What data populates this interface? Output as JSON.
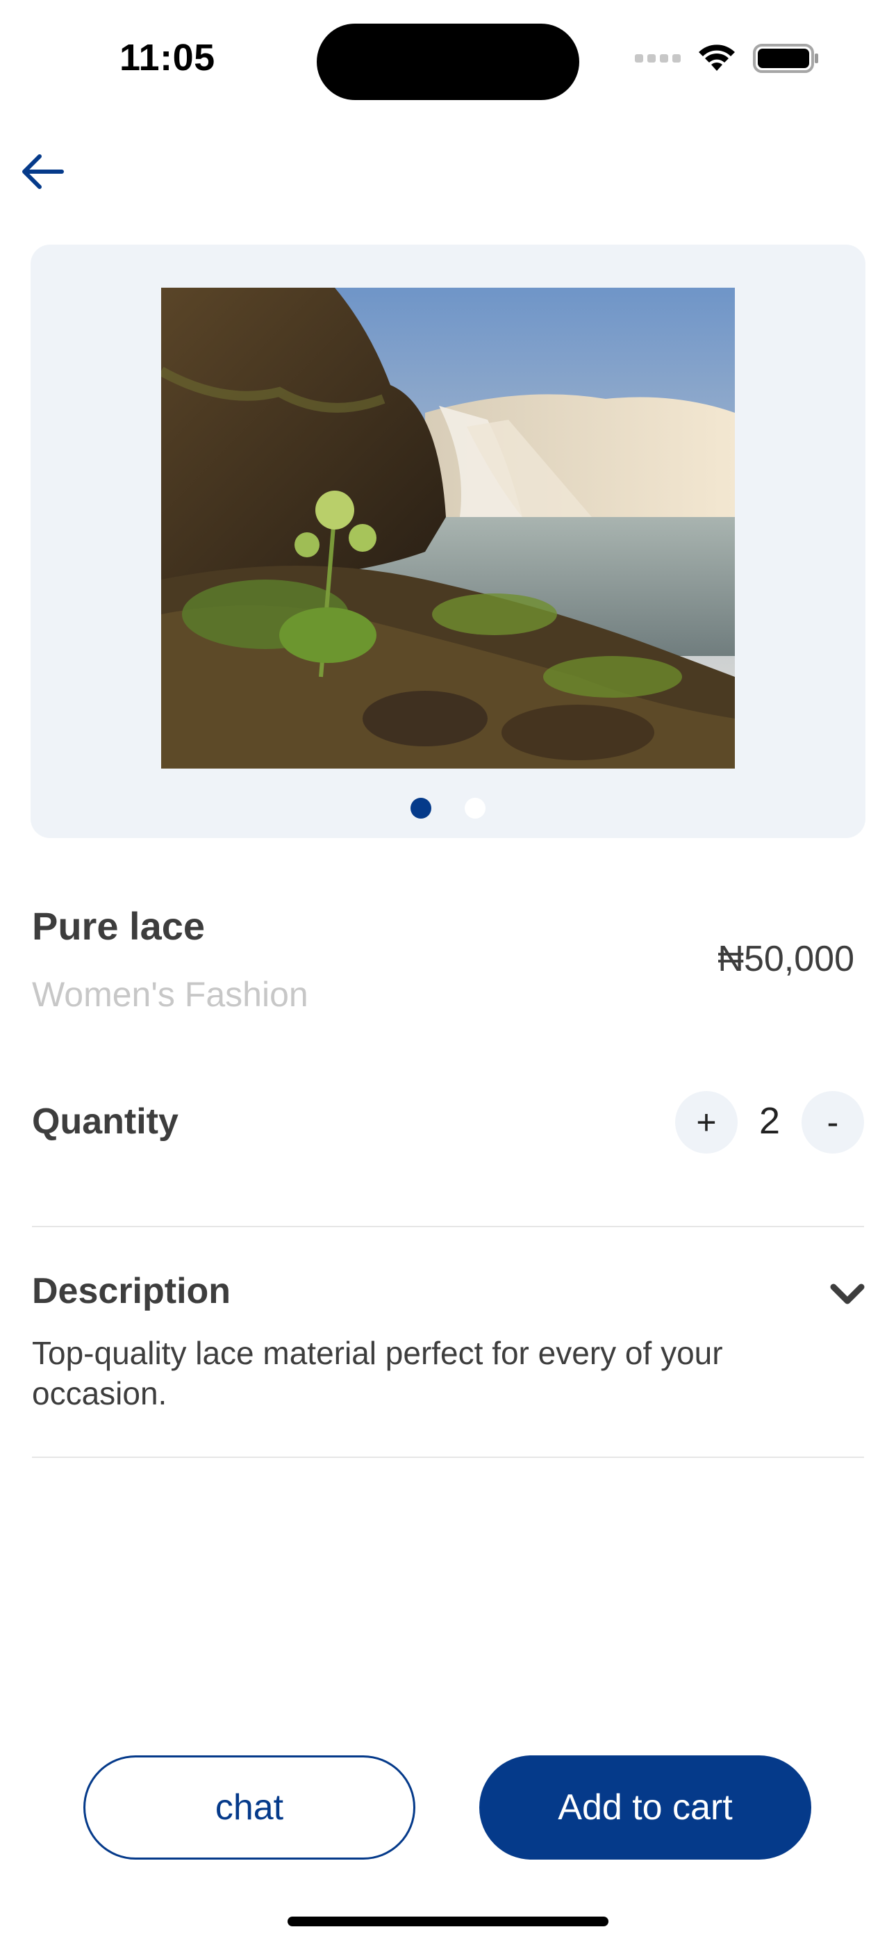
{
  "status_bar": {
    "time": "11:05"
  },
  "product": {
    "name": "Pure lace",
    "category": "Women's Fashion",
    "price": "₦50,000",
    "image_count": 2,
    "active_image_index": 0
  },
  "quantity": {
    "label": "Quantity",
    "increment_label": "+",
    "decrement_label": "-",
    "value": "2"
  },
  "description": {
    "label": "Description",
    "text": "Top-quality lace material perfect for every of your occasion."
  },
  "actions": {
    "chat_label": "chat",
    "add_to_cart_label": "Add to cart"
  },
  "colors": {
    "primary": "#053a8a",
    "surface": "#eff3f8",
    "muted_text": "#c7c7c7"
  },
  "icons": {
    "back": "arrow-left-icon",
    "expand": "chevron-down-icon"
  }
}
